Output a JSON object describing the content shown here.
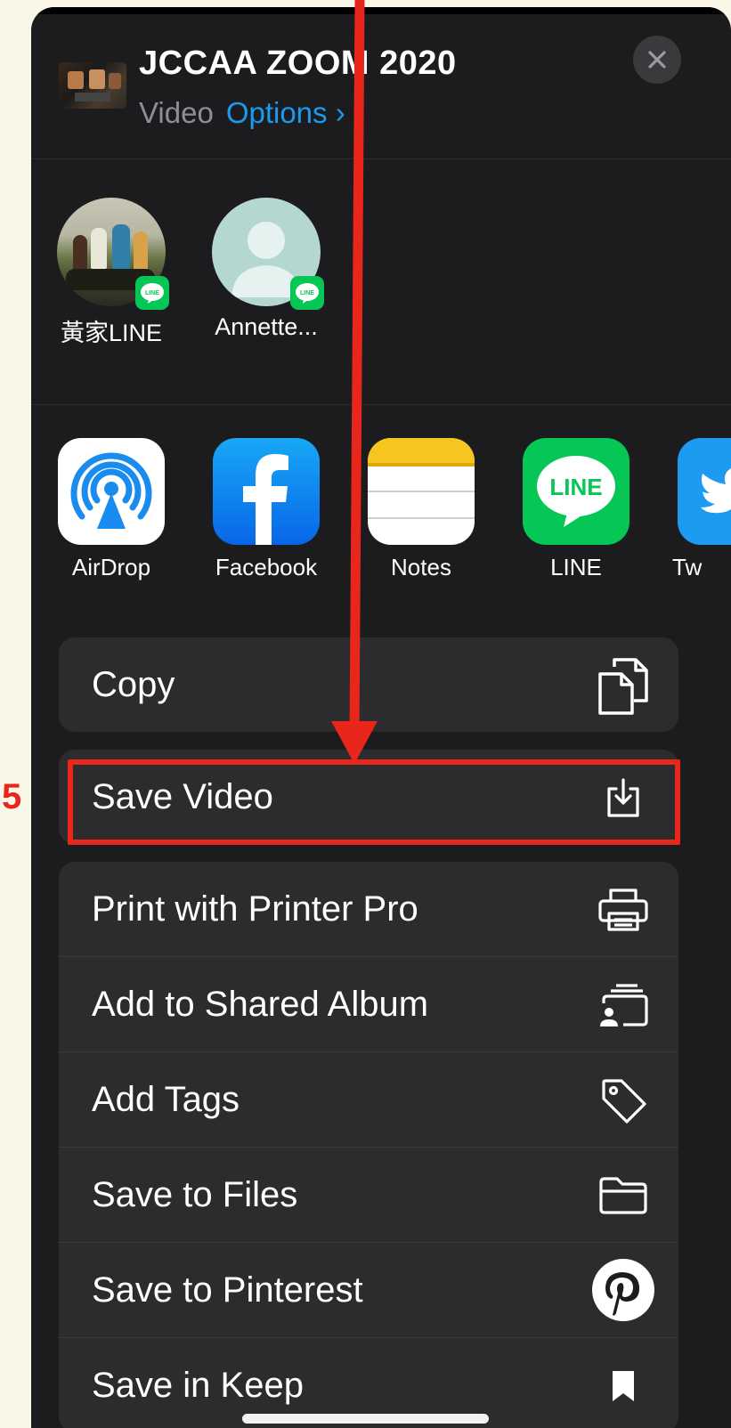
{
  "header": {
    "title": "JCCAA ZOOM 2020",
    "kind": "Video",
    "options_label": "Options",
    "options_chevron": "›"
  },
  "people": [
    {
      "name": "黃家LINE",
      "badge": "LINE"
    },
    {
      "name": "Annette...",
      "badge": "LINE"
    }
  ],
  "apps": [
    {
      "label": "AirDrop",
      "icon": "airdrop-icon"
    },
    {
      "label": "Facebook",
      "icon": "facebook-icon"
    },
    {
      "label": "Notes",
      "icon": "notes-icon"
    },
    {
      "label": "LINE",
      "icon": "line-app-icon",
      "icon_text": "LINE"
    },
    {
      "label": "Tw",
      "icon": "twitter-icon"
    }
  ],
  "actions": {
    "copy": {
      "label": "Copy",
      "icon": "copy-icon"
    },
    "save_video": {
      "label": "Save Video",
      "icon": "download-icon"
    },
    "list": [
      {
        "label": "Print with Printer Pro",
        "icon": "printer-icon"
      },
      {
        "label": "Add to Shared Album",
        "icon": "shared-album-icon"
      },
      {
        "label": "Add Tags",
        "icon": "tag-icon"
      },
      {
        "label": "Save to Files",
        "icon": "folder-icon"
      },
      {
        "label": "Save to Pinterest",
        "icon": "pinterest-icon"
      },
      {
        "label": "Save in Keep",
        "icon": "bookmark-icon"
      }
    ]
  },
  "annotation": {
    "step_number": "5",
    "color": "#e8261c"
  },
  "colors": {
    "sheet_bg": "#1c1c1e",
    "row_bg": "#2c2c2e",
    "accent_blue": "#1a9bf0",
    "line_green": "#06c755",
    "page_bg": "#fbf7e8"
  }
}
